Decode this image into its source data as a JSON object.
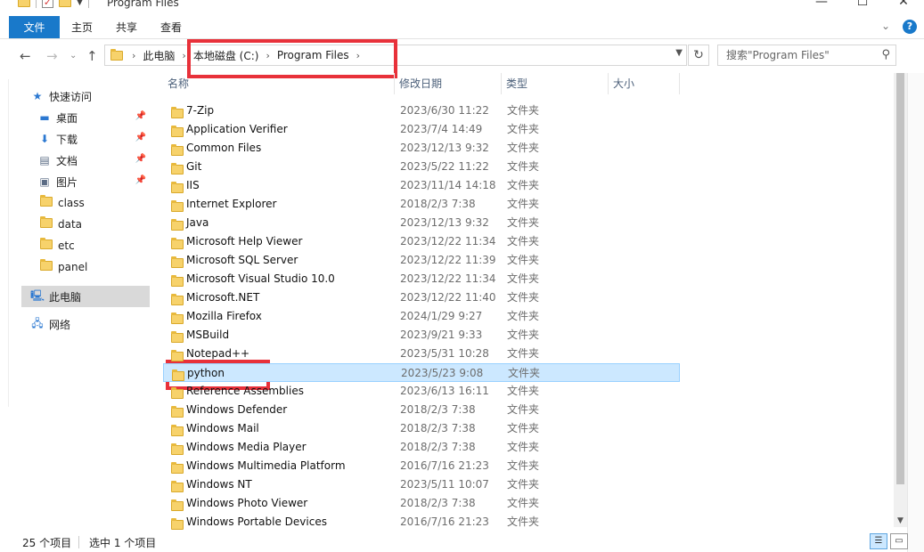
{
  "window": {
    "title": "Program Files",
    "controls": {
      "minimize": "—",
      "maximize": "☐",
      "close": "✕"
    }
  },
  "ribbon": {
    "tabs": [
      "文件",
      "主页",
      "共享",
      "查看"
    ]
  },
  "address": {
    "crumbs": [
      "此电脑",
      "本地磁盘 (C:)",
      "Program Files"
    ],
    "search_placeholder": "搜索\"Program Files\""
  },
  "nav": {
    "quick_access": "快速访问",
    "pinned": [
      "桌面",
      "下载",
      "文档",
      "图片"
    ],
    "folders": [
      "class",
      "data",
      "etc",
      "panel"
    ],
    "this_pc": "此电脑",
    "network": "网络"
  },
  "columns": [
    "名称",
    "修改日期",
    "类型",
    "大小"
  ],
  "files": [
    {
      "name": "7-Zip",
      "date": "2023/6/30 11:22",
      "type": "文件夹"
    },
    {
      "name": "Application Verifier",
      "date": "2023/7/4 14:49",
      "type": "文件夹"
    },
    {
      "name": "Common Files",
      "date": "2023/12/13 9:32",
      "type": "文件夹"
    },
    {
      "name": "Git",
      "date": "2023/5/22 11:22",
      "type": "文件夹"
    },
    {
      "name": "IIS",
      "date": "2023/11/14 14:18",
      "type": "文件夹"
    },
    {
      "name": "Internet Explorer",
      "date": "2018/2/3 7:38",
      "type": "文件夹"
    },
    {
      "name": "Java",
      "date": "2023/12/13 9:32",
      "type": "文件夹"
    },
    {
      "name": "Microsoft Help Viewer",
      "date": "2023/12/22 11:34",
      "type": "文件夹"
    },
    {
      "name": "Microsoft SQL Server",
      "date": "2023/12/22 11:39",
      "type": "文件夹"
    },
    {
      "name": "Microsoft Visual Studio 10.0",
      "date": "2023/12/22 11:34",
      "type": "文件夹"
    },
    {
      "name": "Microsoft.NET",
      "date": "2023/12/22 11:40",
      "type": "文件夹"
    },
    {
      "name": "Mozilla Firefox",
      "date": "2024/1/29 9:27",
      "type": "文件夹"
    },
    {
      "name": "MSBuild",
      "date": "2023/9/21 9:33",
      "type": "文件夹"
    },
    {
      "name": "Notepad++",
      "date": "2023/5/31 10:28",
      "type": "文件夹"
    },
    {
      "name": "python",
      "date": "2023/5/23 9:08",
      "type": "文件夹",
      "selected": true
    },
    {
      "name": "Reference Assemblies",
      "date": "2023/6/13 16:11",
      "type": "文件夹"
    },
    {
      "name": "Windows Defender",
      "date": "2018/2/3 7:38",
      "type": "文件夹"
    },
    {
      "name": "Windows Mail",
      "date": "2018/2/3 7:38",
      "type": "文件夹"
    },
    {
      "name": "Windows Media Player",
      "date": "2018/2/3 7:38",
      "type": "文件夹"
    },
    {
      "name": "Windows Multimedia Platform",
      "date": "2016/7/16 21:23",
      "type": "文件夹"
    },
    {
      "name": "Windows NT",
      "date": "2023/5/11 10:07",
      "type": "文件夹"
    },
    {
      "name": "Windows Photo Viewer",
      "date": "2018/2/3 7:38",
      "type": "文件夹"
    },
    {
      "name": "Windows Portable Devices",
      "date": "2016/7/16 21:23",
      "type": "文件夹"
    }
  ],
  "status": {
    "count": "25 个项目",
    "selected": "选中 1 个项目"
  },
  "colors": {
    "accent": "#1979ca",
    "selection": "#cce8ff",
    "highlight_box": "#e8313a"
  }
}
